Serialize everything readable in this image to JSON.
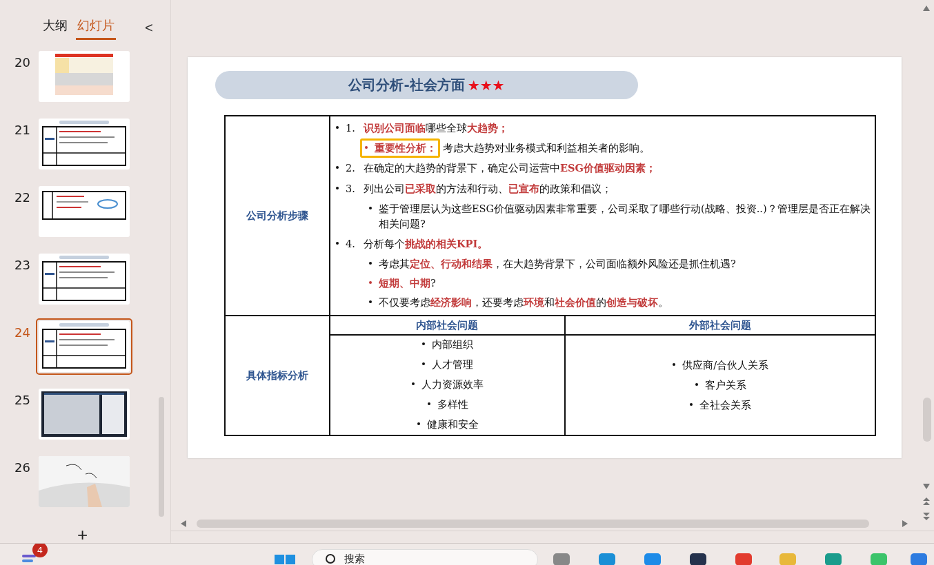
{
  "panel": {
    "tabs": [
      {
        "label": "大纲",
        "selected": false
      },
      {
        "label": "幻灯片",
        "selected": true
      }
    ],
    "collapse": "<",
    "slides": [
      {
        "number": "20",
        "kind": "table",
        "selected": false
      },
      {
        "number": "21",
        "kind": "table",
        "selected": false
      },
      {
        "number": "22",
        "kind": "diagram",
        "selected": false
      },
      {
        "number": "23",
        "kind": "table",
        "selected": false
      },
      {
        "number": "24",
        "kind": "table",
        "selected": true
      },
      {
        "number": "25",
        "kind": "dark",
        "selected": false
      },
      {
        "number": "26",
        "kind": "picture",
        "selected": false
      }
    ],
    "add": "+"
  },
  "slide": {
    "title": "公司分析-社会方面",
    "stars": "★★★",
    "steps_label": "公司分析步骤",
    "steps": [
      {
        "number": "1.",
        "text": "**识别公司面临**哪些全球**大趋势；**",
        "children": [
          {
            "label": "重要性分析：",
            "text": "考虑大趋势对业务模式和利益相关者的影响。",
            "emphasis": true,
            "highlighted": true
          }
        ]
      },
      {
        "number": "2.",
        "text": "在确定的大趋势的背景下，确定公司运营中**ESG价值驱动因素；**"
      },
      {
        "number": "3.",
        "text": "列出公司**已采取**的方法和行动、**已宣布**的政策和倡议；",
        "children": [
          {
            "text": "鉴于管理层认为这些ESG价值驱动因素非常重要，公司采取了哪些行动(战略、投资..)？管理层是否正在解决相关问题?",
            "emphasis": false,
            "highlighted": false
          }
        ]
      },
      {
        "number": "4.",
        "text": "分析每个**挑战的相关KPI。**",
        "children": [
          {
            "text": "考虑其**定位、行动和结果**，在大趋势背景下，公司面临额外风险还是抓住机遇?",
            "emphasis": false,
            "highlighted": false
          },
          {
            "text": "**短期、中期**?",
            "emphasis": true,
            "highlighted": false
          },
          {
            "text": "不仅要考虑**经济影响**，还要考虑**环境**和**社会价值**的**创造与破坏**。",
            "emphasis": false,
            "highlighted": false
          }
        ]
      }
    ],
    "indicators_label": "具体指标分析",
    "columns": [
      {
        "heading": "内部社会问题",
        "items": [
          "内部组织",
          "人才管理",
          "人力资源效率",
          "多样性",
          "健康和安全"
        ]
      },
      {
        "heading": "外部社会问题",
        "items": [
          "供应商/合伙人关系",
          "客户关系",
          "全社会关系"
        ]
      }
    ]
  },
  "taskbar": {
    "badge": "4",
    "search_placeholder": "搜索"
  }
}
